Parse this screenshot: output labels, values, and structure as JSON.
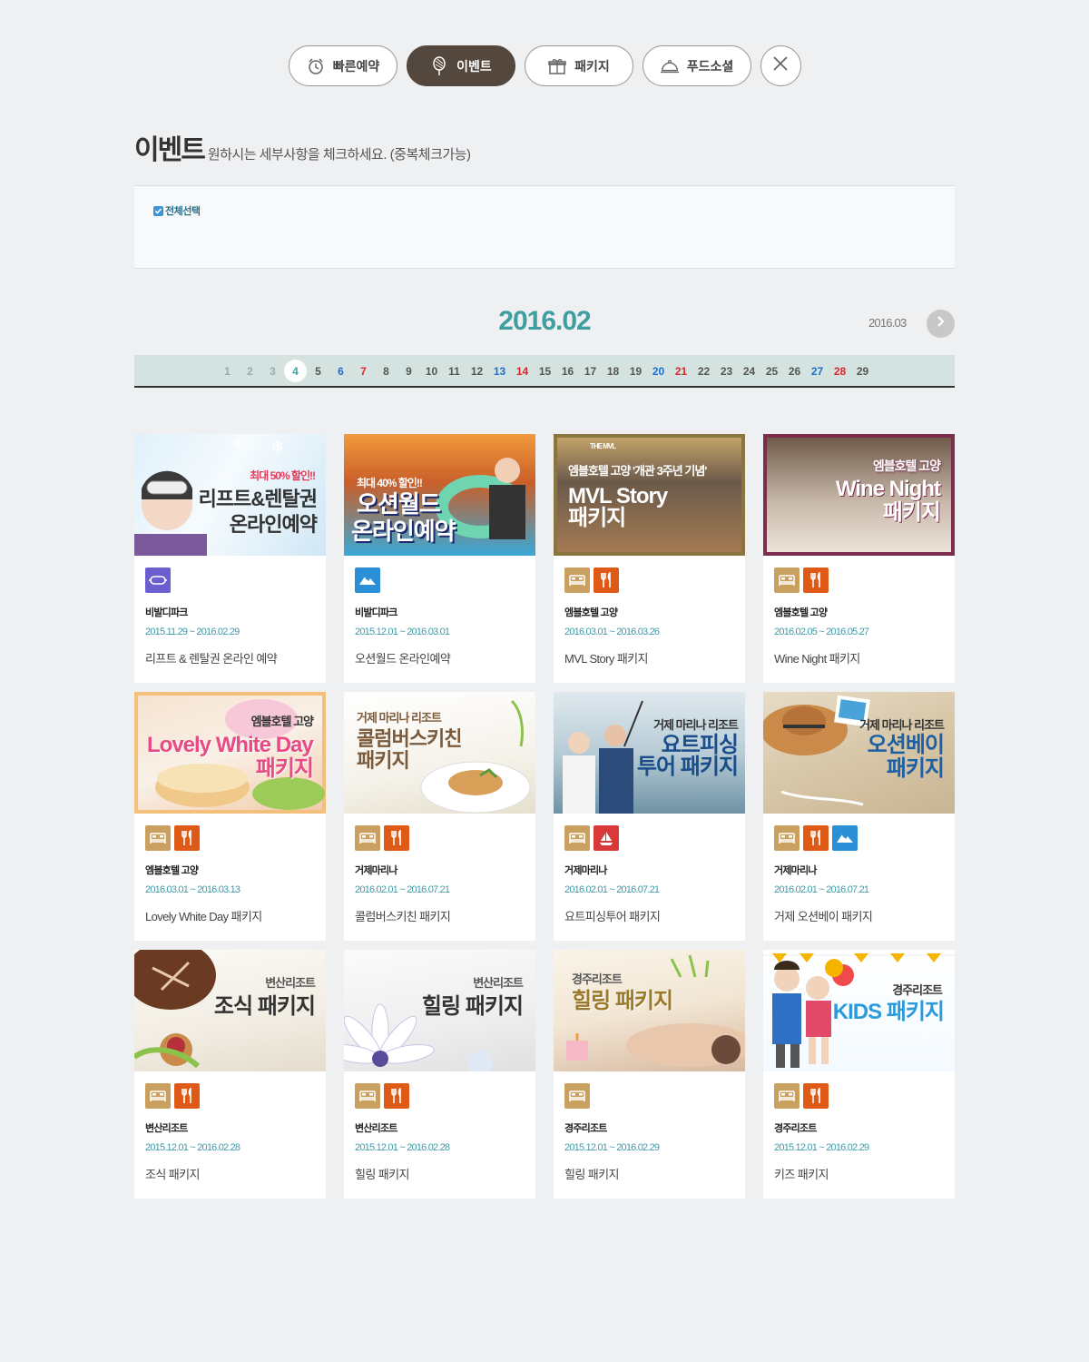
{
  "nav": {
    "tabs": [
      {
        "label": "빠른예약",
        "icon": "alarm-clock-icon"
      },
      {
        "label": "이벤트",
        "icon": "balloon-icon"
      },
      {
        "label": "패키지",
        "icon": "gift-box-icon"
      },
      {
        "label": "푸드소셜",
        "icon": "food-cloche-icon"
      }
    ],
    "active_index": 1,
    "close_icon": "close-icon"
  },
  "heading": {
    "title": "이벤트",
    "subtitle": "원하시는 세부사항을 체크하세요. (중복체크가능)"
  },
  "filter": {
    "select_all_label": "전체선택",
    "select_all_checked": true
  },
  "calendar": {
    "current_month": "2016.02",
    "next_month": "2016.03",
    "days": [
      {
        "n": "1",
        "type": "past"
      },
      {
        "n": "2",
        "type": "past"
      },
      {
        "n": "3",
        "type": "past"
      },
      {
        "n": "4",
        "type": "today"
      },
      {
        "n": "5",
        "type": "normal"
      },
      {
        "n": "6",
        "type": "sat"
      },
      {
        "n": "7",
        "type": "sun"
      },
      {
        "n": "8",
        "type": "normal"
      },
      {
        "n": "9",
        "type": "normal"
      },
      {
        "n": "10",
        "type": "normal"
      },
      {
        "n": "11",
        "type": "normal"
      },
      {
        "n": "12",
        "type": "normal"
      },
      {
        "n": "13",
        "type": "sat"
      },
      {
        "n": "14",
        "type": "sun"
      },
      {
        "n": "15",
        "type": "normal"
      },
      {
        "n": "16",
        "type": "normal"
      },
      {
        "n": "17",
        "type": "normal"
      },
      {
        "n": "18",
        "type": "normal"
      },
      {
        "n": "19",
        "type": "normal"
      },
      {
        "n": "20",
        "type": "sat"
      },
      {
        "n": "21",
        "type": "sun"
      },
      {
        "n": "22",
        "type": "normal"
      },
      {
        "n": "23",
        "type": "normal"
      },
      {
        "n": "24",
        "type": "normal"
      },
      {
        "n": "25",
        "type": "normal"
      },
      {
        "n": "26",
        "type": "normal"
      },
      {
        "n": "27",
        "type": "sat"
      },
      {
        "n": "28",
        "type": "sun"
      },
      {
        "n": "29",
        "type": "normal"
      }
    ]
  },
  "colors": {
    "accent": "#3f9fa0",
    "active_tab": "#54483e",
    "saturday": "#1a6fd0",
    "sunday": "#d9262f",
    "hotel_icon": "#c9a060",
    "food_icon": "#e05a17"
  },
  "events": [
    {
      "banner": {
        "lines": [
          "최대 50% 할인!!",
          "리프트&렌탈권",
          "온라인예약"
        ]
      },
      "icons": [
        "ski"
      ],
      "place": "비발디파크",
      "date": "2015.11.29 ~ 2016.02.29",
      "title": "리프트 & 렌탈권 온라인 예약"
    },
    {
      "banner": {
        "lines": [
          "최대 40% 할인!!",
          "오션월드",
          "온라인예약"
        ]
      },
      "icons": [
        "water"
      ],
      "place": "비발디파크",
      "date": "2015.12.01 ~ 2016.03.01",
      "title": "오션월드 온라인예약"
    },
    {
      "banner": {
        "lines": [
          "THE MVL",
          "엠블호텔 고양 '개관 3주년 기념'",
          "MVL Story",
          "패키지"
        ]
      },
      "icons": [
        "hotel",
        "food"
      ],
      "place": "엠블호텔 고양",
      "date": "2016.03.01 ~ 2016.03.26",
      "title": "MVL Story 패키지"
    },
    {
      "banner": {
        "lines": [
          "엠블호텔 고양",
          "Wine Night",
          "패키지"
        ]
      },
      "icons": [
        "hotel",
        "food"
      ],
      "place": "엠블호텔 고양",
      "date": "2016.02.05 ~ 2016.05.27",
      "title": "Wine Night 패키지"
    },
    {
      "banner": {
        "lines": [
          "엠블호텔 고양",
          "Lovely White Day",
          "패키지"
        ]
      },
      "icons": [
        "hotel",
        "food"
      ],
      "place": "엠블호텔 고양",
      "date": "2016.03.01 ~ 2016.03.13",
      "title": "Lovely White Day 패키지"
    },
    {
      "banner": {
        "lines": [
          "거제 마리나 리조트",
          "콜럼버스키친",
          "패키지"
        ]
      },
      "icons": [
        "hotel",
        "food"
      ],
      "place": "거제마리나",
      "date": "2016.02.01 ~ 2016.07.21",
      "title": "콜럼버스키친 패키지"
    },
    {
      "banner": {
        "lines": [
          "거제 마리나 리조트",
          "요트피싱",
          "투어 패키지"
        ]
      },
      "icons": [
        "hotel",
        "yacht"
      ],
      "place": "거제마리나",
      "date": "2016.02.01 ~ 2016.07.21",
      "title": "요트피싱투어 패키지"
    },
    {
      "banner": {
        "lines": [
          "거제 마리나 리조트",
          "오션베이",
          "패키지"
        ]
      },
      "icons": [
        "hotel",
        "food",
        "water"
      ],
      "place": "거제마리나",
      "date": "2016.02.01 ~ 2016.07.21",
      "title": "거제 오션베이 패키지"
    },
    {
      "banner": {
        "lines": [
          "변산리조트",
          "조식 패키지"
        ]
      },
      "icons": [
        "hotel",
        "food"
      ],
      "place": "변산리조트",
      "date": "2015.12.01 ~ 2016.02.28",
      "title": "조식 패키지"
    },
    {
      "banner": {
        "lines": [
          "변산리조트",
          "힐링 패키지"
        ]
      },
      "icons": [
        "hotel",
        "food"
      ],
      "place": "변산리조트",
      "date": "2015.12.01 ~ 2016.02.28",
      "title": "힐링 패키지"
    },
    {
      "banner": {
        "lines": [
          "경주리조트",
          "힐링 패키지"
        ]
      },
      "icons": [
        "hotel"
      ],
      "place": "경주리조트",
      "date": "2015.12.01 ~ 2016.02.29",
      "title": "힐링 패키지"
    },
    {
      "banner": {
        "lines": [
          "경주리조트",
          "KIDS 패키지"
        ]
      },
      "icons": [
        "hotel",
        "food"
      ],
      "place": "경주리조트",
      "date": "2015.12.01 ~ 2016.02.29",
      "title": "키즈 패키지"
    }
  ]
}
